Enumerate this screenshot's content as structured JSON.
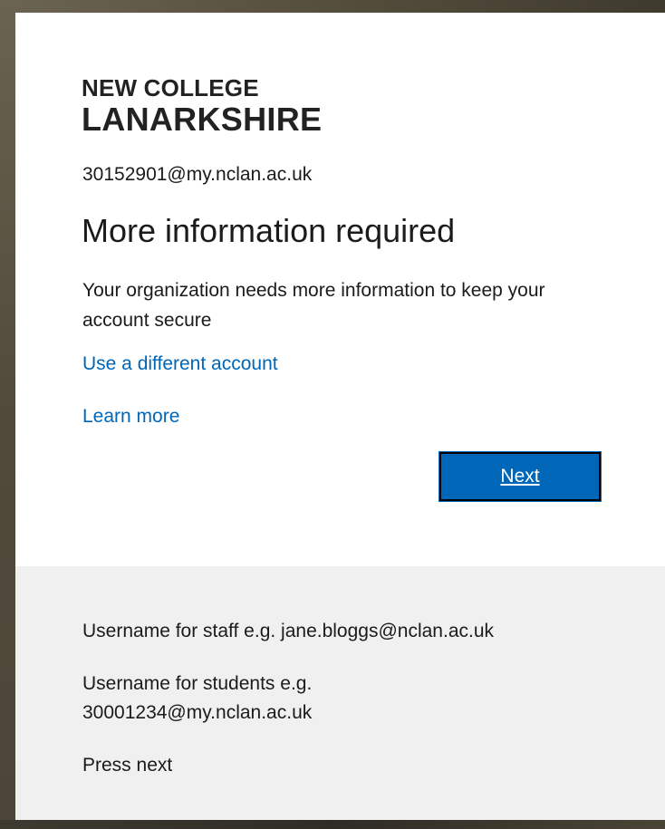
{
  "logo": {
    "line1": "NEW COLLEGE",
    "line2": "LANARKSHIRE"
  },
  "account": {
    "email": "30152901@my.nclan.ac.uk"
  },
  "main": {
    "title": "More information required",
    "description": "Your organization needs more information to keep your account secure",
    "use_different_account": "Use a different account",
    "learn_more": "Learn more",
    "next_label": "Next"
  },
  "footer": {
    "staff_hint": "Username for staff e.g. jane.bloggs@nclan.ac.uk",
    "students_hint_line1": "Username for students e.g.",
    "students_hint_line2": "30001234@my.nclan.ac.uk",
    "press_next": "Press next"
  },
  "colors": {
    "accent": "#0067b8",
    "footer_bg": "#f0f0f0",
    "text": "#1b1b1b"
  }
}
